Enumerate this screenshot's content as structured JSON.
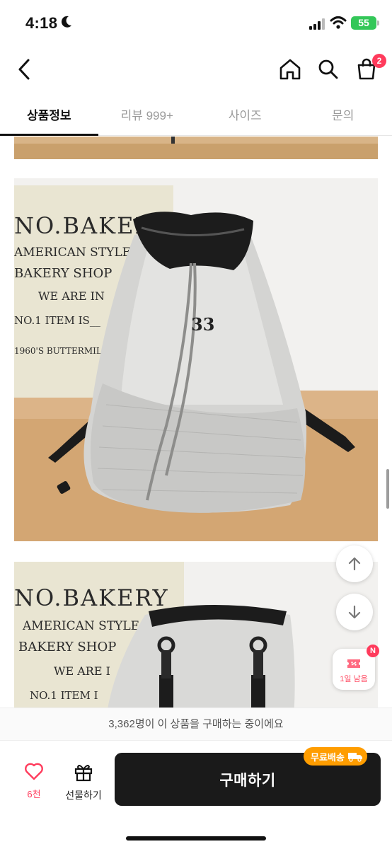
{
  "status_bar": {
    "time": "4:18",
    "battery": "55"
  },
  "header": {
    "cart_count": "2"
  },
  "tabs": [
    {
      "label": "상품정보",
      "active": true
    },
    {
      "label": "리뷰 999+",
      "active": false
    },
    {
      "label": "사이즈",
      "active": false
    },
    {
      "label": "문의",
      "active": false
    }
  ],
  "photos": {
    "photo2": {
      "sign_lines": [
        "NO.BAKERY",
        "AMERICAN STYLE",
        "BAKERY SHOP",
        "WE ARE IN",
        "NO.1 ITEM IS__",
        "1960'S BUTTERMILK"
      ],
      "bag_logo": "33"
    },
    "photo3": {
      "sign_lines": [
        "NO.BAKERY",
        "AMERICAN STYLE",
        "BAKERY SHOP",
        "WE ARE I",
        "NO.1 ITEM I"
      ]
    }
  },
  "floating": {
    "coupon_label": "1일 남음",
    "coupon_badge": "N"
  },
  "notice": "3,362명이 이 상품을 구매하는 중이에요",
  "bottom_bar": {
    "like_count": "6천",
    "gift_label": "선물하기",
    "buy_label": "구매하기",
    "free_shipping_label": "무료배송"
  },
  "colors": {
    "accent": "#ff3b5c",
    "buy_button": "#1a1a1a",
    "free_ship": "#ff9d00"
  }
}
